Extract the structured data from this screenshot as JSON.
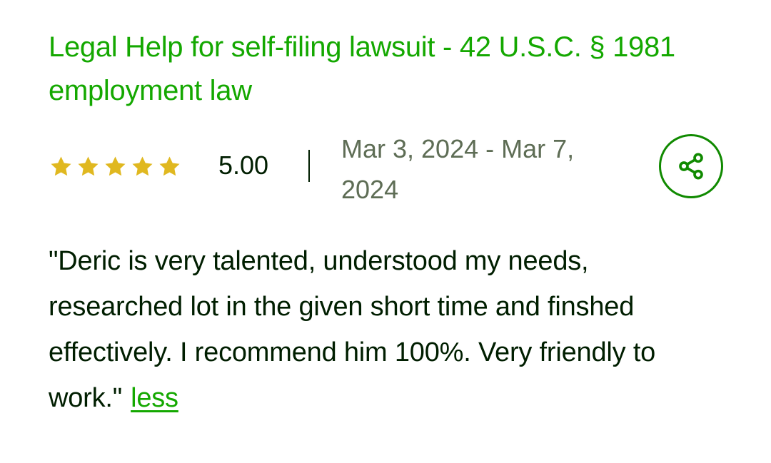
{
  "job": {
    "title": "Legal Help for self-filing lawsuit - 42 U.S.C. § 1981 employment law"
  },
  "rating": {
    "stars": 5,
    "value": "5.00",
    "star_color": "#e0b820",
    "icon": "star-icon"
  },
  "date_range": "Mar 3, 2024 - Mar 7, 2024",
  "share": {
    "icon": "share-icon",
    "color": "#108a00"
  },
  "review": {
    "text": "\"Deric is very talented, understood my needs, researched lot in the given short time and finshed effectively. I recommend him 100%. Very friendly to work.\"",
    "less_label": "less"
  },
  "colors": {
    "accent": "#14a800",
    "text": "#001e00",
    "muted": "#5e6d55"
  }
}
